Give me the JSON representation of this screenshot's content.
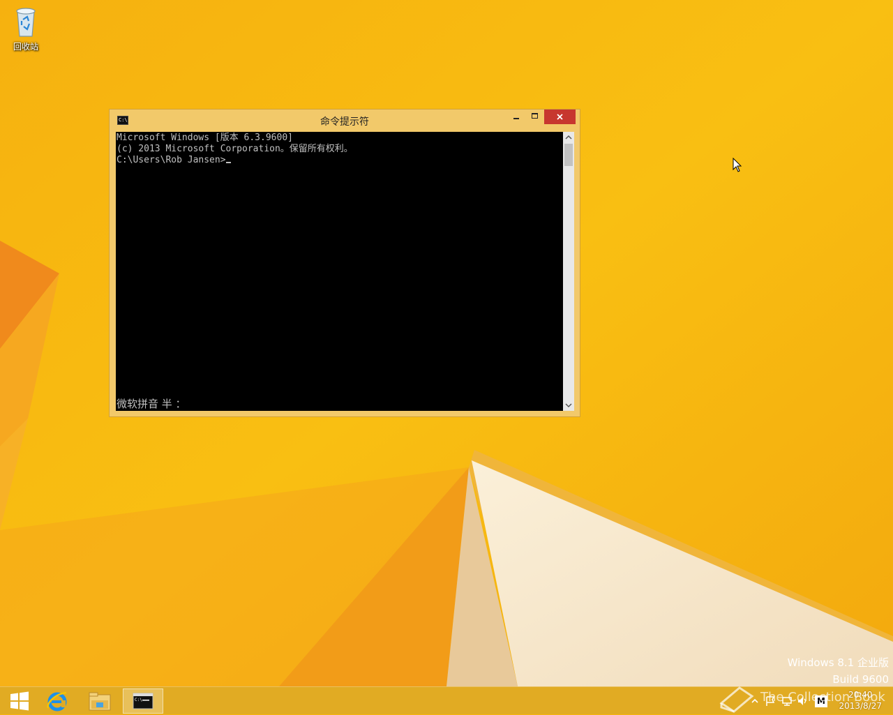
{
  "desktop": {
    "icons": [
      {
        "label": "回收站",
        "icon": "recycle-bin-icon"
      }
    ]
  },
  "cmd_window": {
    "title": "命令提示符",
    "lines": [
      "Microsoft Windows [版本 6.3.9600]",
      "(c) 2013 Microsoft Corporation。保留所有权利。",
      "",
      "C:\\Users\\Rob Jansen>"
    ],
    "ime_status": "微软拼音 半 ：",
    "colors": {
      "background": "#000000",
      "text": "#c0c0c0",
      "frame": "#f2c96a",
      "close": "#c7372f"
    }
  },
  "watermark": {
    "line1": "Windows 8.1 企业版",
    "line2": "Build 9600"
  },
  "overlay_text": "The Collection Book",
  "taskbar": {
    "buttons": [
      {
        "name": "start-button",
        "icon": "windows-logo-icon"
      },
      {
        "name": "ie-button",
        "icon": "internet-explorer-icon"
      },
      {
        "name": "explorer-button",
        "icon": "file-explorer-icon"
      },
      {
        "name": "cmd-task-button",
        "icon": "command-prompt-icon",
        "active": true
      }
    ],
    "tray": {
      "icons": [
        "chevron-up-icon",
        "flag-icon",
        "network-icon",
        "volume-icon",
        "ime-m-icon"
      ],
      "ime_label": "M",
      "time": "20:40",
      "date": "2013/8/27"
    }
  }
}
